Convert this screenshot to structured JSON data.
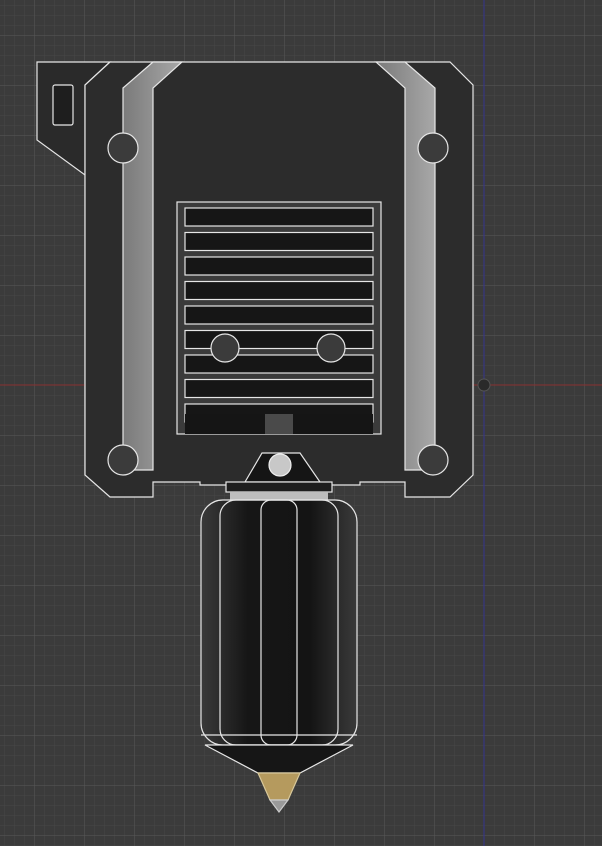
{
  "viewport": {
    "background_color": "#3b3b3b",
    "grid_minor_color": "#474747",
    "grid_major_color": "#555555",
    "x_axis_color": "#8a2d2d",
    "y_axis_color": "#2d2d8a"
  },
  "model": {
    "body_color": "#2c2c2c",
    "rail_color": "#9a9a9a",
    "edge_color": "#e6e6e6",
    "brass_color": "#b59a5e",
    "nozzle_body_color": "#1a1a1a"
  }
}
